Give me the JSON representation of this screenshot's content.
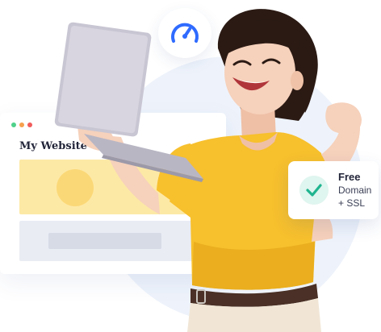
{
  "website_card": {
    "title": "My Website",
    "window_dots": [
      {
        "name": "dot-green",
        "color": "#4fd18b"
      },
      {
        "name": "dot-orange",
        "color": "#f6a04d"
      },
      {
        "name": "dot-red",
        "color": "#f15b5b"
      }
    ]
  },
  "speed_badge": {
    "icon": "speedometer-icon",
    "color": "#2f6bff"
  },
  "feature_card": {
    "title": "Free",
    "line1": "Domain",
    "line2": "+ SSL",
    "icon": "checkmark-icon",
    "icon_color": "#1fb58f"
  },
  "colors": {
    "shirt": "#f7c02d",
    "belt": "#4a3026",
    "pants": "#f1e6d6",
    "hair": "#2b1a14",
    "skin": "#f6d1bb",
    "laptop": "#c9c6d3",
    "background_circle": "#eef3fb"
  }
}
